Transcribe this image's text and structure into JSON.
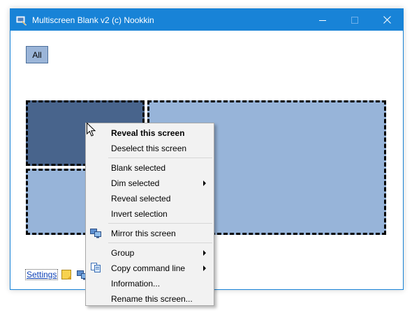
{
  "window": {
    "title": "Multiscreen Blank v2 (c) Nookkin",
    "accent_color": "#1883d7",
    "icons": [
      "app-icon",
      "minimize-icon",
      "maximize-icon",
      "close-icon"
    ]
  },
  "toolbar": {
    "all_label": "All"
  },
  "screens": [
    {
      "state": "selected",
      "color": "#48648c"
    },
    {
      "state": "unselected",
      "color": "#97b4d9"
    },
    {
      "state": "unselected",
      "color": "#97b4d9"
    }
  ],
  "footer": {
    "settings_label": "Settings",
    "icons": [
      "note-icon",
      "monitors-icon"
    ]
  },
  "context_menu": {
    "items": [
      {
        "label": "Reveal this screen",
        "bold": true
      },
      {
        "label": "Deselect this screen"
      },
      {
        "label": "Blank selected"
      },
      {
        "label": "Dim selected",
        "submenu": true
      },
      {
        "label": "Reveal selected"
      },
      {
        "label": "Invert selection"
      },
      {
        "label": "Mirror this screen",
        "icon": "mirror-icon"
      },
      {
        "label": "Group",
        "submenu": true
      },
      {
        "label": "Copy command line",
        "submenu": true,
        "icon": "copy-icon"
      },
      {
        "label": "Information..."
      },
      {
        "label": "Rename this screen..."
      }
    ]
  }
}
